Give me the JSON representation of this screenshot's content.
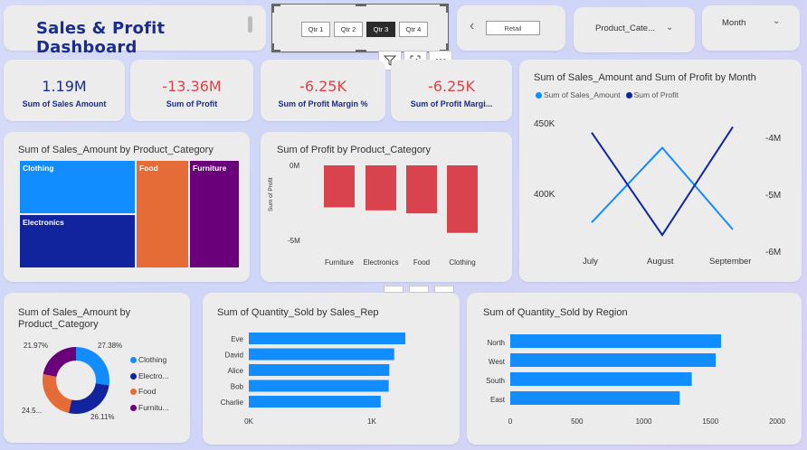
{
  "header": {
    "title": "Sales & Profit Dashboard"
  },
  "quarter_slicer": {
    "options": [
      "Qtr 1",
      "Qtr 2",
      "Qtr 3",
      "Qtr 4"
    ],
    "selected": "Qtr 3"
  },
  "retail_slicer": {
    "value": "Retail"
  },
  "product_slicer": {
    "label": "Product_Cate..."
  },
  "month_slicer": {
    "label": "Month"
  },
  "kpis": [
    {
      "value": "1.19M",
      "label": "Sum of Sales Amount",
      "color": "#1a2c8f"
    },
    {
      "value": "-13.36M",
      "label": "Sum of Profit",
      "color": "#d9434d"
    },
    {
      "value": "-6.25K",
      "label": "Sum of Profit Margin %",
      "color": "#d9434d"
    },
    {
      "value": "-6.25K",
      "label": "Sum of Profit Margi...",
      "color": "#d9434d"
    }
  ],
  "colors": {
    "blue": "#118dff",
    "navy": "#12239e",
    "orange": "#e66c37",
    "purple": "#6b007b",
    "red": "#d9434d"
  },
  "chart_data": [
    {
      "type": "treemap",
      "title": "Sum of Sales_Amount by Product_Category",
      "categories": [
        "Clothing",
        "Electronics",
        "Food",
        "Furniture"
      ],
      "values": [
        27.38,
        26.11,
        24.54,
        21.97
      ]
    },
    {
      "type": "bar",
      "title": "Sum of Profit by Product_Category",
      "categories": [
        "Furniture",
        "Electronics",
        "Food",
        "Clothing"
      ],
      "values": [
        -2.8,
        -3.0,
        -3.2,
        -4.5
      ],
      "ylabel": "Sum of Profit",
      "yticks": [
        "0M",
        "-5M"
      ],
      "ylim": [
        -5,
        0
      ]
    },
    {
      "type": "line",
      "title": "Sum of Sales_Amount and Sum of Profit by Month",
      "categories": [
        "July",
        "August",
        "September"
      ],
      "series": [
        {
          "name": "Sum of Sales_Amount",
          "values": [
            380,
            433,
            375
          ],
          "color": "#118dff"
        },
        {
          "name": "Sum of Profit",
          "values": [
            -3.9,
            -5.7,
            -3.8
          ],
          "color": "#12239e"
        }
      ],
      "left_ticks": [
        "450K",
        "400K"
      ],
      "right_ticks": [
        "-4M",
        "-5M",
        "-6M"
      ]
    },
    {
      "type": "pie",
      "title": "Sum of Sales_Amount by Product_Category",
      "categories": [
        "Clothing",
        "Electro...",
        "Food",
        "Furnitu..."
      ],
      "values": [
        27.38,
        26.11,
        24.54,
        21.97
      ],
      "labels": [
        "27.38%",
        "26.11%",
        "24.5...",
        "21.97%"
      ]
    },
    {
      "type": "bar",
      "orientation": "horizontal",
      "title": "Sum of Quantity_Sold by Sales_Rep",
      "categories": [
        "Eve",
        "David",
        "Alice",
        "Bob",
        "Charlie"
      ],
      "values": [
        1270,
        1180,
        1140,
        1135,
        1070
      ],
      "xticks": [
        "0K",
        "1K"
      ],
      "xlim": [
        0,
        1600
      ]
    },
    {
      "type": "bar",
      "orientation": "horizontal",
      "title": "Sum of Quantity_Sold by Region",
      "categories": [
        "North",
        "West",
        "South",
        "East"
      ],
      "values": [
        1580,
        1540,
        1360,
        1270
      ],
      "xticks": [
        "0",
        "500",
        "1000",
        "1500",
        "2000"
      ],
      "xlim": [
        0,
        2000
      ]
    }
  ]
}
